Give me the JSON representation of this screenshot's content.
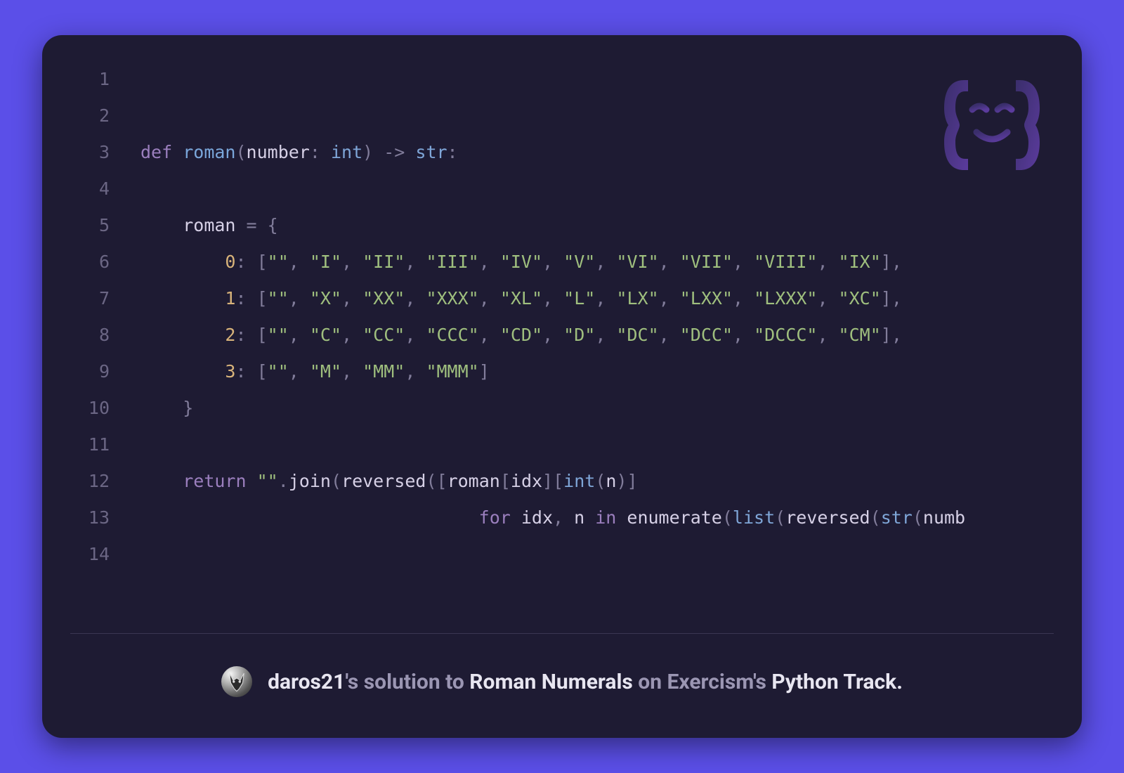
{
  "lines": [
    {
      "n": "1",
      "tokens": []
    },
    {
      "n": "2",
      "tokens": []
    },
    {
      "n": "3",
      "tokens": [
        {
          "t": "def ",
          "c": "kw"
        },
        {
          "t": "roman",
          "c": "fn"
        },
        {
          "t": "(",
          "c": "punct"
        },
        {
          "t": "number",
          "c": "name"
        },
        {
          "t": ": ",
          "c": "punct"
        },
        {
          "t": "int",
          "c": "type"
        },
        {
          "t": ") ",
          "c": "punct"
        },
        {
          "t": "-> ",
          "c": "op"
        },
        {
          "t": "str",
          "c": "type"
        },
        {
          "t": ":",
          "c": "punct"
        }
      ]
    },
    {
      "n": "4",
      "tokens": []
    },
    {
      "n": "5",
      "tokens": [
        {
          "t": "    ",
          "c": "code"
        },
        {
          "t": "roman ",
          "c": "name"
        },
        {
          "t": "= ",
          "c": "op"
        },
        {
          "t": "{",
          "c": "punct"
        }
      ]
    },
    {
      "n": "6",
      "tokens": [
        {
          "t": "        ",
          "c": "code"
        },
        {
          "t": "0",
          "c": "num"
        },
        {
          "t": ": [",
          "c": "punct"
        },
        {
          "t": "\"\"",
          "c": "str"
        },
        {
          "t": ", ",
          "c": "punct"
        },
        {
          "t": "\"I\"",
          "c": "str"
        },
        {
          "t": ", ",
          "c": "punct"
        },
        {
          "t": "\"II\"",
          "c": "str"
        },
        {
          "t": ", ",
          "c": "punct"
        },
        {
          "t": "\"III\"",
          "c": "str"
        },
        {
          "t": ", ",
          "c": "punct"
        },
        {
          "t": "\"IV\"",
          "c": "str"
        },
        {
          "t": ", ",
          "c": "punct"
        },
        {
          "t": "\"V\"",
          "c": "str"
        },
        {
          "t": ", ",
          "c": "punct"
        },
        {
          "t": "\"VI\"",
          "c": "str"
        },
        {
          "t": ", ",
          "c": "punct"
        },
        {
          "t": "\"VII\"",
          "c": "str"
        },
        {
          "t": ", ",
          "c": "punct"
        },
        {
          "t": "\"VIII\"",
          "c": "str"
        },
        {
          "t": ", ",
          "c": "punct"
        },
        {
          "t": "\"IX\"",
          "c": "str"
        },
        {
          "t": "],",
          "c": "punct"
        }
      ]
    },
    {
      "n": "7",
      "tokens": [
        {
          "t": "        ",
          "c": "code"
        },
        {
          "t": "1",
          "c": "num"
        },
        {
          "t": ": [",
          "c": "punct"
        },
        {
          "t": "\"\"",
          "c": "str"
        },
        {
          "t": ", ",
          "c": "punct"
        },
        {
          "t": "\"X\"",
          "c": "str"
        },
        {
          "t": ", ",
          "c": "punct"
        },
        {
          "t": "\"XX\"",
          "c": "str"
        },
        {
          "t": ", ",
          "c": "punct"
        },
        {
          "t": "\"XXX\"",
          "c": "str"
        },
        {
          "t": ", ",
          "c": "punct"
        },
        {
          "t": "\"XL\"",
          "c": "str"
        },
        {
          "t": ", ",
          "c": "punct"
        },
        {
          "t": "\"L\"",
          "c": "str"
        },
        {
          "t": ", ",
          "c": "punct"
        },
        {
          "t": "\"LX\"",
          "c": "str"
        },
        {
          "t": ", ",
          "c": "punct"
        },
        {
          "t": "\"LXX\"",
          "c": "str"
        },
        {
          "t": ", ",
          "c": "punct"
        },
        {
          "t": "\"LXXX\"",
          "c": "str"
        },
        {
          "t": ", ",
          "c": "punct"
        },
        {
          "t": "\"XC\"",
          "c": "str"
        },
        {
          "t": "],",
          "c": "punct"
        }
      ]
    },
    {
      "n": "8",
      "tokens": [
        {
          "t": "        ",
          "c": "code"
        },
        {
          "t": "2",
          "c": "num"
        },
        {
          "t": ": [",
          "c": "punct"
        },
        {
          "t": "\"\"",
          "c": "str"
        },
        {
          "t": ", ",
          "c": "punct"
        },
        {
          "t": "\"C\"",
          "c": "str"
        },
        {
          "t": ", ",
          "c": "punct"
        },
        {
          "t": "\"CC\"",
          "c": "str"
        },
        {
          "t": ", ",
          "c": "punct"
        },
        {
          "t": "\"CCC\"",
          "c": "str"
        },
        {
          "t": ", ",
          "c": "punct"
        },
        {
          "t": "\"CD\"",
          "c": "str"
        },
        {
          "t": ", ",
          "c": "punct"
        },
        {
          "t": "\"D\"",
          "c": "str"
        },
        {
          "t": ", ",
          "c": "punct"
        },
        {
          "t": "\"DC\"",
          "c": "str"
        },
        {
          "t": ", ",
          "c": "punct"
        },
        {
          "t": "\"DCC\"",
          "c": "str"
        },
        {
          "t": ", ",
          "c": "punct"
        },
        {
          "t": "\"DCCC\"",
          "c": "str"
        },
        {
          "t": ", ",
          "c": "punct"
        },
        {
          "t": "\"CM\"",
          "c": "str"
        },
        {
          "t": "],",
          "c": "punct"
        }
      ]
    },
    {
      "n": "9",
      "tokens": [
        {
          "t": "        ",
          "c": "code"
        },
        {
          "t": "3",
          "c": "num"
        },
        {
          "t": ": [",
          "c": "punct"
        },
        {
          "t": "\"\"",
          "c": "str"
        },
        {
          "t": ", ",
          "c": "punct"
        },
        {
          "t": "\"M\"",
          "c": "str"
        },
        {
          "t": ", ",
          "c": "punct"
        },
        {
          "t": "\"MM\"",
          "c": "str"
        },
        {
          "t": ", ",
          "c": "punct"
        },
        {
          "t": "\"MMM\"",
          "c": "str"
        },
        {
          "t": "]",
          "c": "punct"
        }
      ]
    },
    {
      "n": "10",
      "tokens": [
        {
          "t": "    ",
          "c": "code"
        },
        {
          "t": "}",
          "c": "punct"
        }
      ]
    },
    {
      "n": "11",
      "tokens": []
    },
    {
      "n": "12",
      "tokens": [
        {
          "t": "    ",
          "c": "code"
        },
        {
          "t": "return ",
          "c": "kw"
        },
        {
          "t": "\"\"",
          "c": "str"
        },
        {
          "t": ".",
          "c": "punct"
        },
        {
          "t": "join",
          "c": "call"
        },
        {
          "t": "(",
          "c": "punct"
        },
        {
          "t": "reversed",
          "c": "call"
        },
        {
          "t": "([",
          "c": "punct"
        },
        {
          "t": "roman",
          "c": "name"
        },
        {
          "t": "[",
          "c": "punct"
        },
        {
          "t": "idx",
          "c": "name"
        },
        {
          "t": "][",
          "c": "punct"
        },
        {
          "t": "int",
          "c": "type"
        },
        {
          "t": "(",
          "c": "punct"
        },
        {
          "t": "n",
          "c": "name"
        },
        {
          "t": ")]",
          "c": "punct"
        }
      ]
    },
    {
      "n": "13",
      "tokens": [
        {
          "t": "                                ",
          "c": "code"
        },
        {
          "t": "for ",
          "c": "kw"
        },
        {
          "t": "idx",
          "c": "name"
        },
        {
          "t": ", ",
          "c": "punct"
        },
        {
          "t": "n ",
          "c": "name"
        },
        {
          "t": "in ",
          "c": "kw"
        },
        {
          "t": "enumerate",
          "c": "call"
        },
        {
          "t": "(",
          "c": "punct"
        },
        {
          "t": "list",
          "c": "type"
        },
        {
          "t": "(",
          "c": "punct"
        },
        {
          "t": "reversed",
          "c": "call"
        },
        {
          "t": "(",
          "c": "punct"
        },
        {
          "t": "str",
          "c": "type"
        },
        {
          "t": "(",
          "c": "punct"
        },
        {
          "t": "numb",
          "c": "name"
        }
      ]
    },
    {
      "n": "14",
      "tokens": []
    }
  ],
  "credit": {
    "user": "daros21",
    "s1": "'s solution to ",
    "exercise": "Roman Numerals",
    "s2": " on Exercism",
    "s3": "'s ",
    "track": "Python Track."
  }
}
